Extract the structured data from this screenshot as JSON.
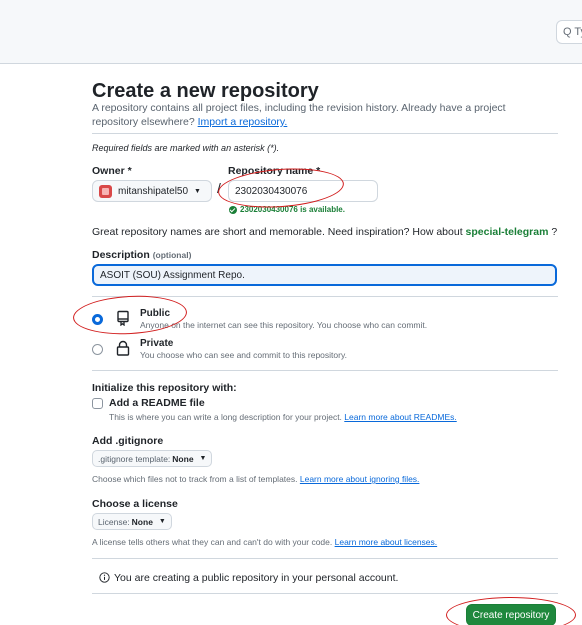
{
  "header": {
    "search_label": "Q Ty"
  },
  "page": {
    "title": "Create a new repository",
    "subtitle_pre": "A repository contains all project files, including the revision history. Already have a project repository elsewhere? ",
    "import_link": "Import a repository.",
    "required_note": "Required fields are marked with an asterisk (*)."
  },
  "owner": {
    "label": "Owner *",
    "value": "mitanshipatel50"
  },
  "repo": {
    "label": "Repository name *",
    "value": "2302030430076",
    "availability": "2302030430076 is available."
  },
  "hint": {
    "text": "Great repository names are short and memorable. Need inspiration? How about ",
    "suggestion": "special-telegram",
    "suffix": " ?"
  },
  "description": {
    "label": "Description",
    "optional": "(optional)",
    "value": "ASOIT (SOU) Assignment Repo."
  },
  "visibility": {
    "public_title": "Public",
    "public_desc": "Anyone on the internet can see this repository. You choose who can commit.",
    "private_title": "Private",
    "private_desc": "You choose who can see and commit to this repository."
  },
  "init": {
    "title": "Initialize this repository with:",
    "readme_label": "Add a README file",
    "readme_desc": "This is where you can write a long description for your project. ",
    "readme_link": "Learn more about READMEs."
  },
  "gitignore": {
    "title": "Add .gitignore",
    "button_prefix": ".gitignore template:",
    "button_value": "None",
    "desc": "Choose which files not to track from a list of templates. ",
    "link": "Learn more about ignoring files."
  },
  "license": {
    "title": "Choose a license",
    "button_prefix": "License:",
    "button_value": "None",
    "desc": "A license tells others what they can and can't do with your code. ",
    "link": "Learn more about licenses."
  },
  "footer": {
    "note": "You are creating a public repository in your personal account.",
    "create_label": "Create repository"
  },
  "colors": {
    "accent": "#0969da",
    "success": "#1a7f37",
    "primary_button": "#1f883d",
    "annotation": "#d21f1f"
  }
}
